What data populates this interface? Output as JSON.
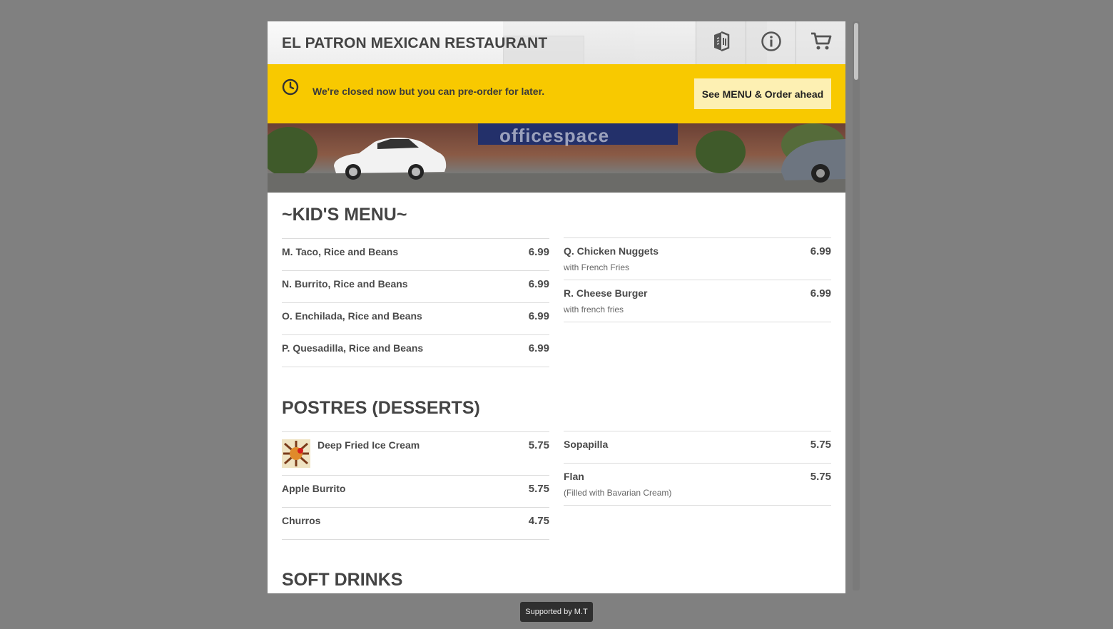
{
  "header": {
    "title": "EL PATRON MEXICAN RESTAURANT",
    "icons": [
      "menu-book-icon",
      "info-icon",
      "cart-icon"
    ]
  },
  "banner": {
    "message": "We're closed now but you can pre-order for later.",
    "button": "See MENU & Order ahead",
    "color": "#f8c900"
  },
  "hero": {
    "watermark": "officespace"
  },
  "sections": [
    {
      "title": "~KID'S MENU~",
      "left": [
        {
          "name": "M. Taco, Rice and Beans",
          "price": "6.99"
        },
        {
          "name": "N. Burrito, Rice and Beans",
          "price": "6.99"
        },
        {
          "name": "O. Enchilada, Rice and Beans",
          "price": "6.99"
        },
        {
          "name": "P. Quesadilla, Rice and Beans",
          "price": "6.99"
        }
      ],
      "right": [
        {
          "name": "Q. Chicken Nuggets",
          "price": "6.99",
          "desc": "with French Fries"
        },
        {
          "name": "R. Cheese Burger",
          "price": "6.99",
          "desc": "with french fries"
        }
      ]
    },
    {
      "title": "POSTRES (DESSERTS)",
      "left": [
        {
          "name": "Deep Fried Ice Cream",
          "price": "5.75"
        },
        {
          "name": "Apple Burrito",
          "price": "5.75"
        },
        {
          "name": "Churros",
          "price": "4.75"
        }
      ],
      "right": [
        {
          "name": "Sopapilla",
          "price": "5.75"
        },
        {
          "name": "Flan",
          "price": "5.75",
          "desc": "(Filled with Bavarian Cream)"
        }
      ]
    },
    {
      "title": "SOFT DRINKS"
    }
  ],
  "footer": {
    "text": "Supported by M.T"
  }
}
